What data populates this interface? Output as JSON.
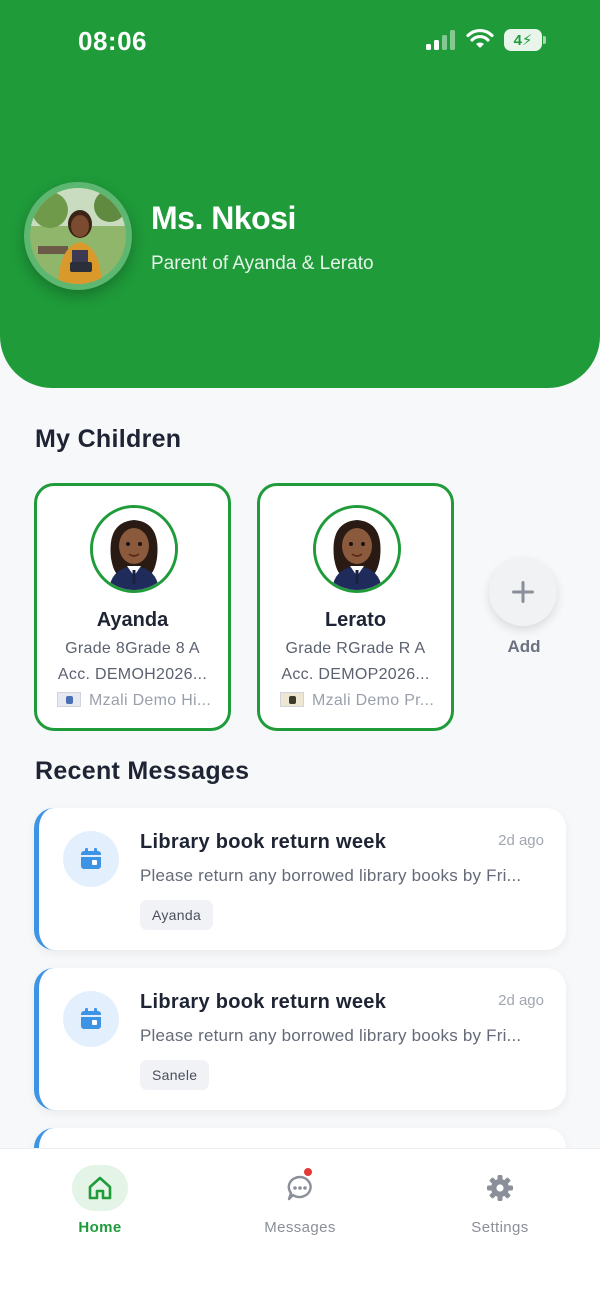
{
  "status_bar": {
    "time": "08:06",
    "battery": "44",
    "battery_display": "4⚡"
  },
  "header": {
    "name": "Ms. Nkosi",
    "subtitle": "Parent of Ayanda & Lerato",
    "accent_color": "#1f9b3a"
  },
  "children_section": {
    "title": "My Children",
    "add_label": "Add",
    "children": [
      {
        "name": "Ayanda",
        "grade": "Grade 8Grade 8 A",
        "account": "Acc. DEMOH2026...",
        "school": "Mzali Demo Hi..."
      },
      {
        "name": "Lerato",
        "grade": "Grade RGrade R A",
        "account": "Acc. DEMOP2026...",
        "school": "Mzali Demo Pr..."
      }
    ]
  },
  "messages_section": {
    "title": "Recent Messages",
    "messages": [
      {
        "title": "Library book return week",
        "time": "2d ago",
        "body": "Please return any borrowed library books by Fri...",
        "tag": "Ayanda",
        "icon": "calendar-icon"
      },
      {
        "title": "Library book return week",
        "time": "2d ago",
        "body": "Please return any borrowed library books by Fri...",
        "tag": "Sanele",
        "icon": "calendar-icon"
      }
    ]
  },
  "tabbar": {
    "tabs": [
      {
        "label": "Home",
        "icon": "home-icon",
        "active": true
      },
      {
        "label": "Messages",
        "icon": "chat-icon",
        "active": false
      },
      {
        "label": "Settings",
        "icon": "gear-icon",
        "active": false
      }
    ]
  }
}
